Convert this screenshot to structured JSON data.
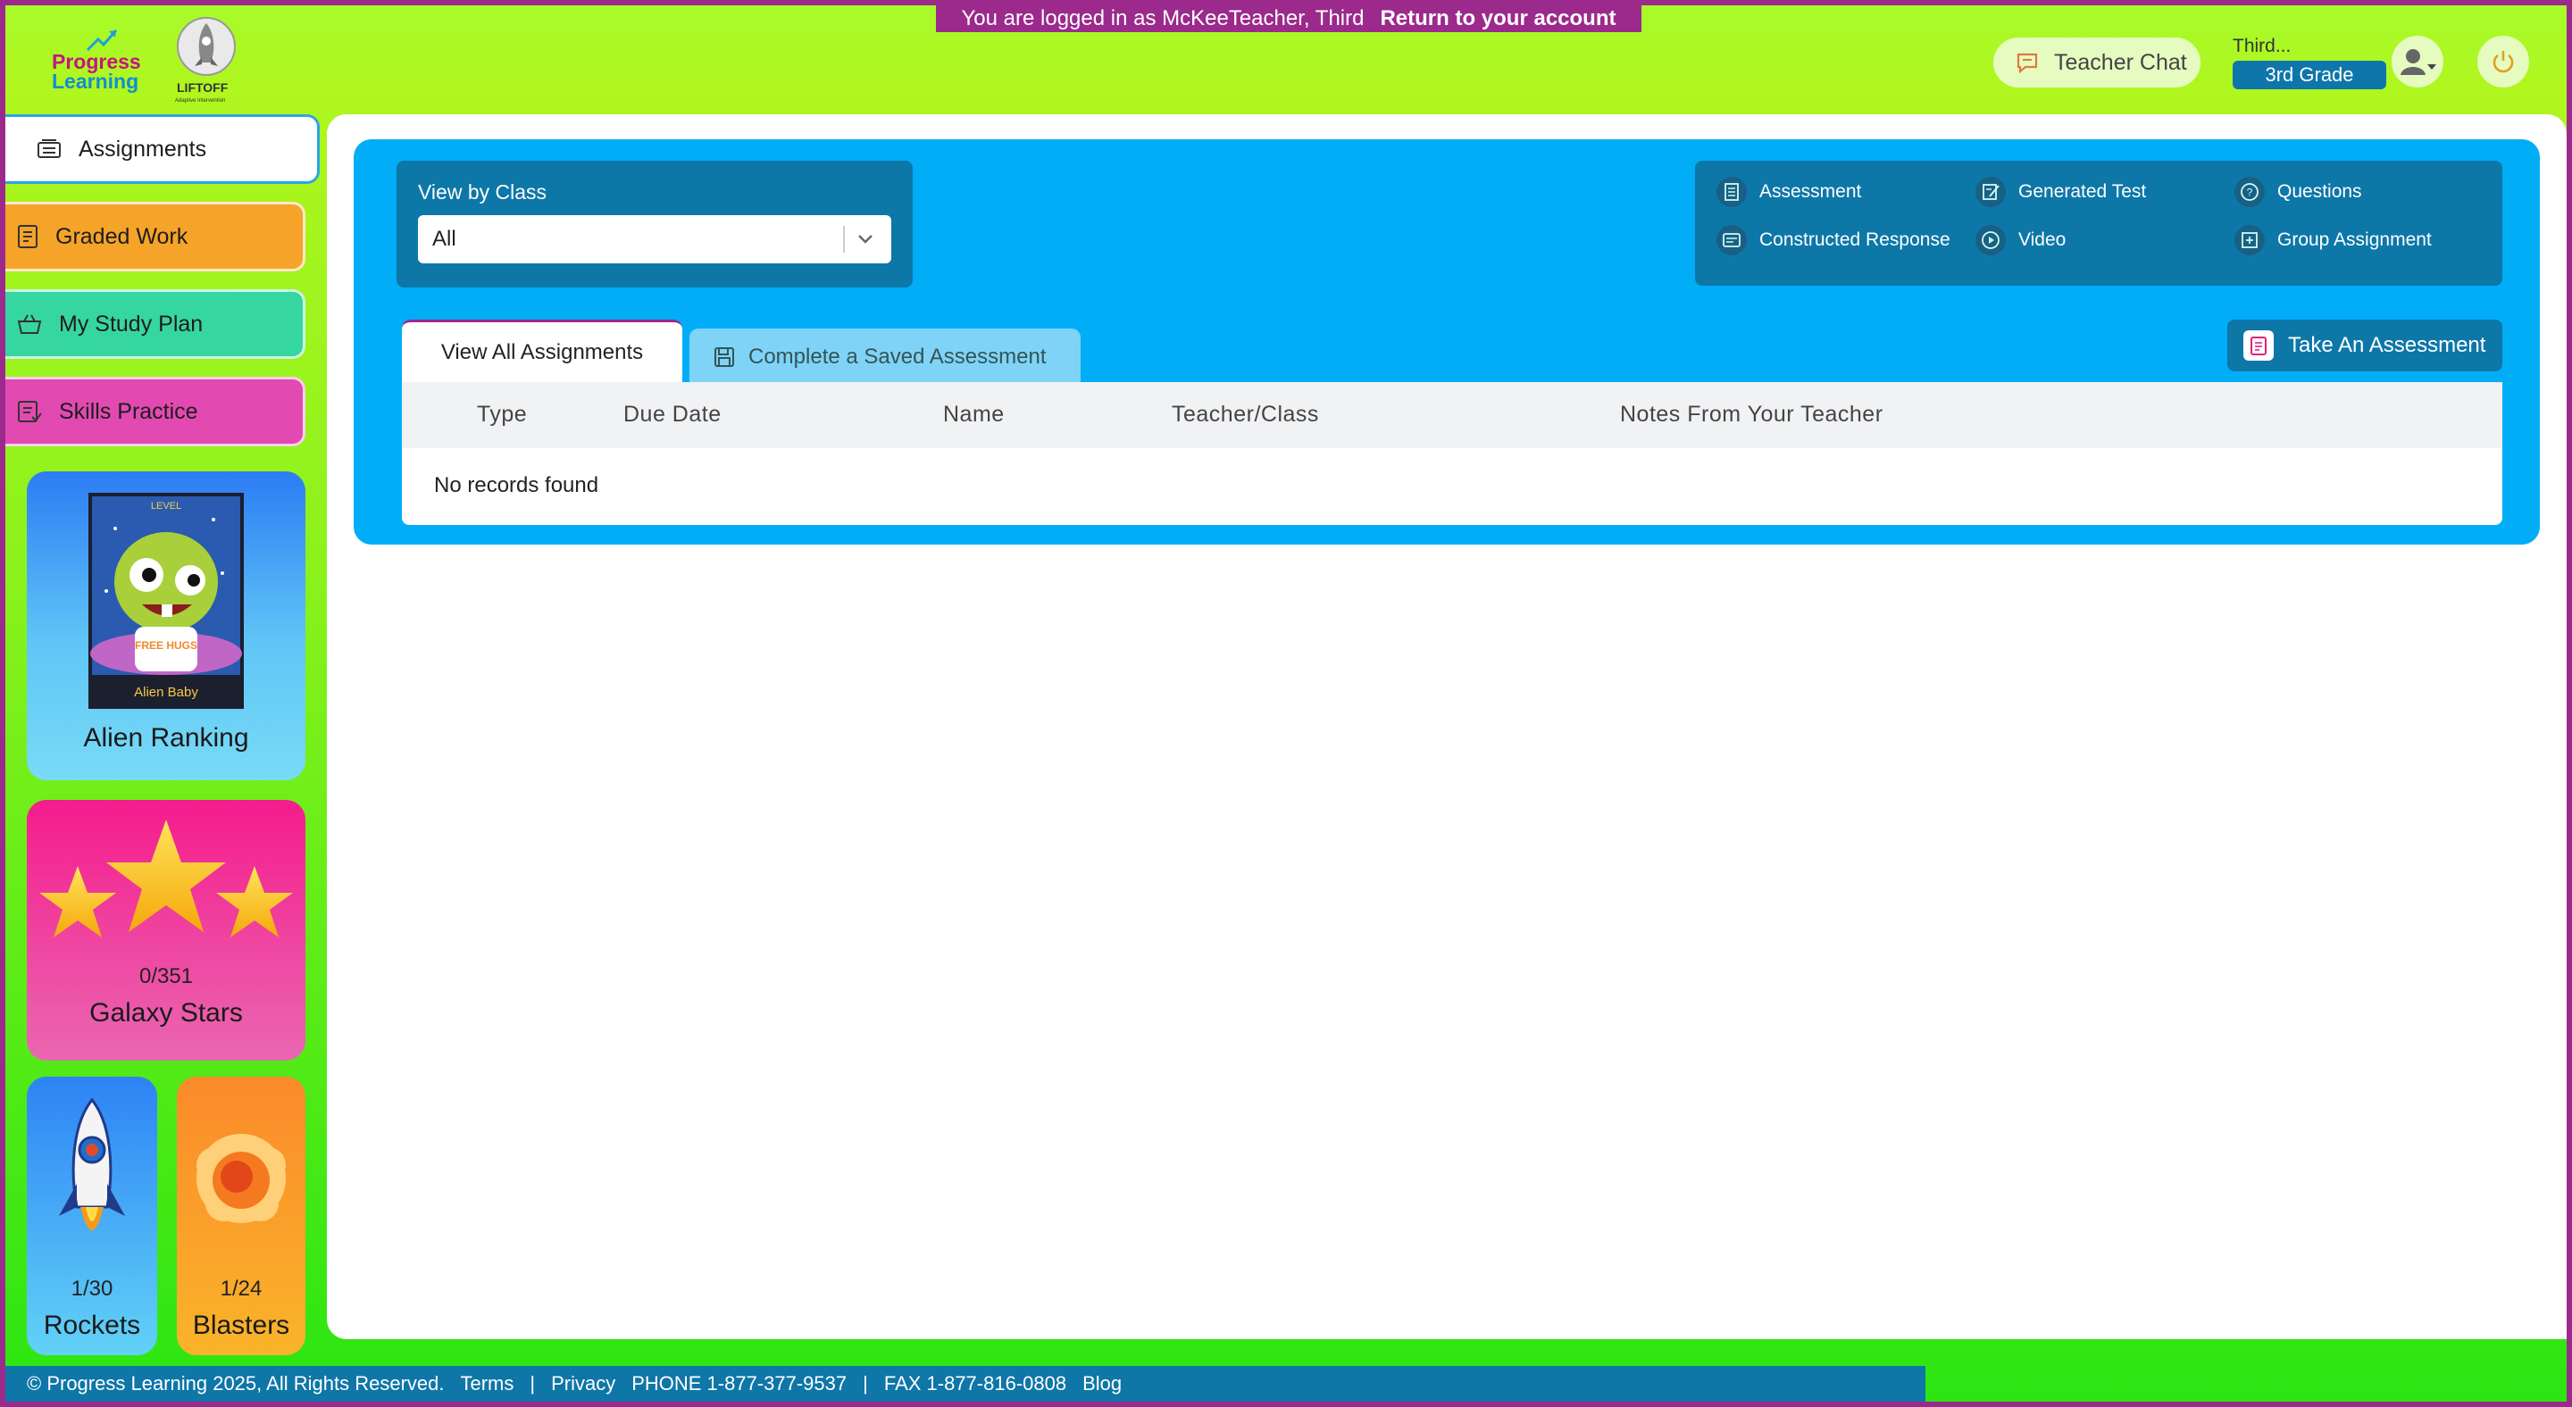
{
  "impersonation": {
    "text": "You are logged in as McKeeTeacher, Third",
    "return_label": "Return to your account"
  },
  "header": {
    "logo_progress": "Progress",
    "logo_learning": "Learning",
    "logo_liftoff": "LIFTOFF",
    "logo_liftoff_sub": "Adaptive Intervention",
    "teacher_chat": "Teacher Chat",
    "user_name": "Third...",
    "user_grade": "3rd Grade"
  },
  "sidebar": {
    "items": [
      {
        "label": "Assignments",
        "icon": "assignments-icon"
      },
      {
        "label": "Graded Work",
        "icon": "graded-work-icon"
      },
      {
        "label": "My Study Plan",
        "icon": "study-plan-icon"
      },
      {
        "label": "Skills Practice",
        "icon": "skills-practice-icon"
      }
    ],
    "alien": {
      "card_top": "LEVEL",
      "card_shirt": "FREE HUGS",
      "card_name": "Alien Baby",
      "label": "Alien Ranking"
    },
    "stars": {
      "count": "0/351",
      "label": "Galaxy Stars"
    },
    "rockets": {
      "count": "1/30",
      "label": "Rockets"
    },
    "blasters": {
      "count": "1/24",
      "label": "Blasters"
    }
  },
  "filter": {
    "label": "View by Class",
    "selected": "All"
  },
  "legend": {
    "items": [
      {
        "label": "Assessment",
        "icon": "assessment-icon"
      },
      {
        "label": "Generated Test",
        "icon": "generated-test-icon"
      },
      {
        "label": "Questions",
        "icon": "questions-icon"
      },
      {
        "label": "Constructed Response",
        "icon": "constructed-response-icon"
      },
      {
        "label": "Video",
        "icon": "video-icon"
      },
      {
        "label": "Group Assignment",
        "icon": "group-assignment-icon"
      }
    ]
  },
  "tabs": {
    "view_all": "View All Assignments",
    "saved": "Complete a Saved Assessment"
  },
  "take_assessment": "Take An Assessment",
  "table": {
    "headers": [
      "Type",
      "Due Date",
      "Name",
      "Teacher/Class",
      "Notes From Your Teacher"
    ],
    "empty": "No records found"
  },
  "footer": {
    "copyright": "© Progress Learning 2025, All Rights Reserved.",
    "terms": "Terms",
    "sep1": "|",
    "privacy": "Privacy",
    "phone": "PHONE 1-877-377-9537",
    "sep2": "|",
    "fax": "FAX 1-877-816-0808",
    "blog": "Blog"
  }
}
